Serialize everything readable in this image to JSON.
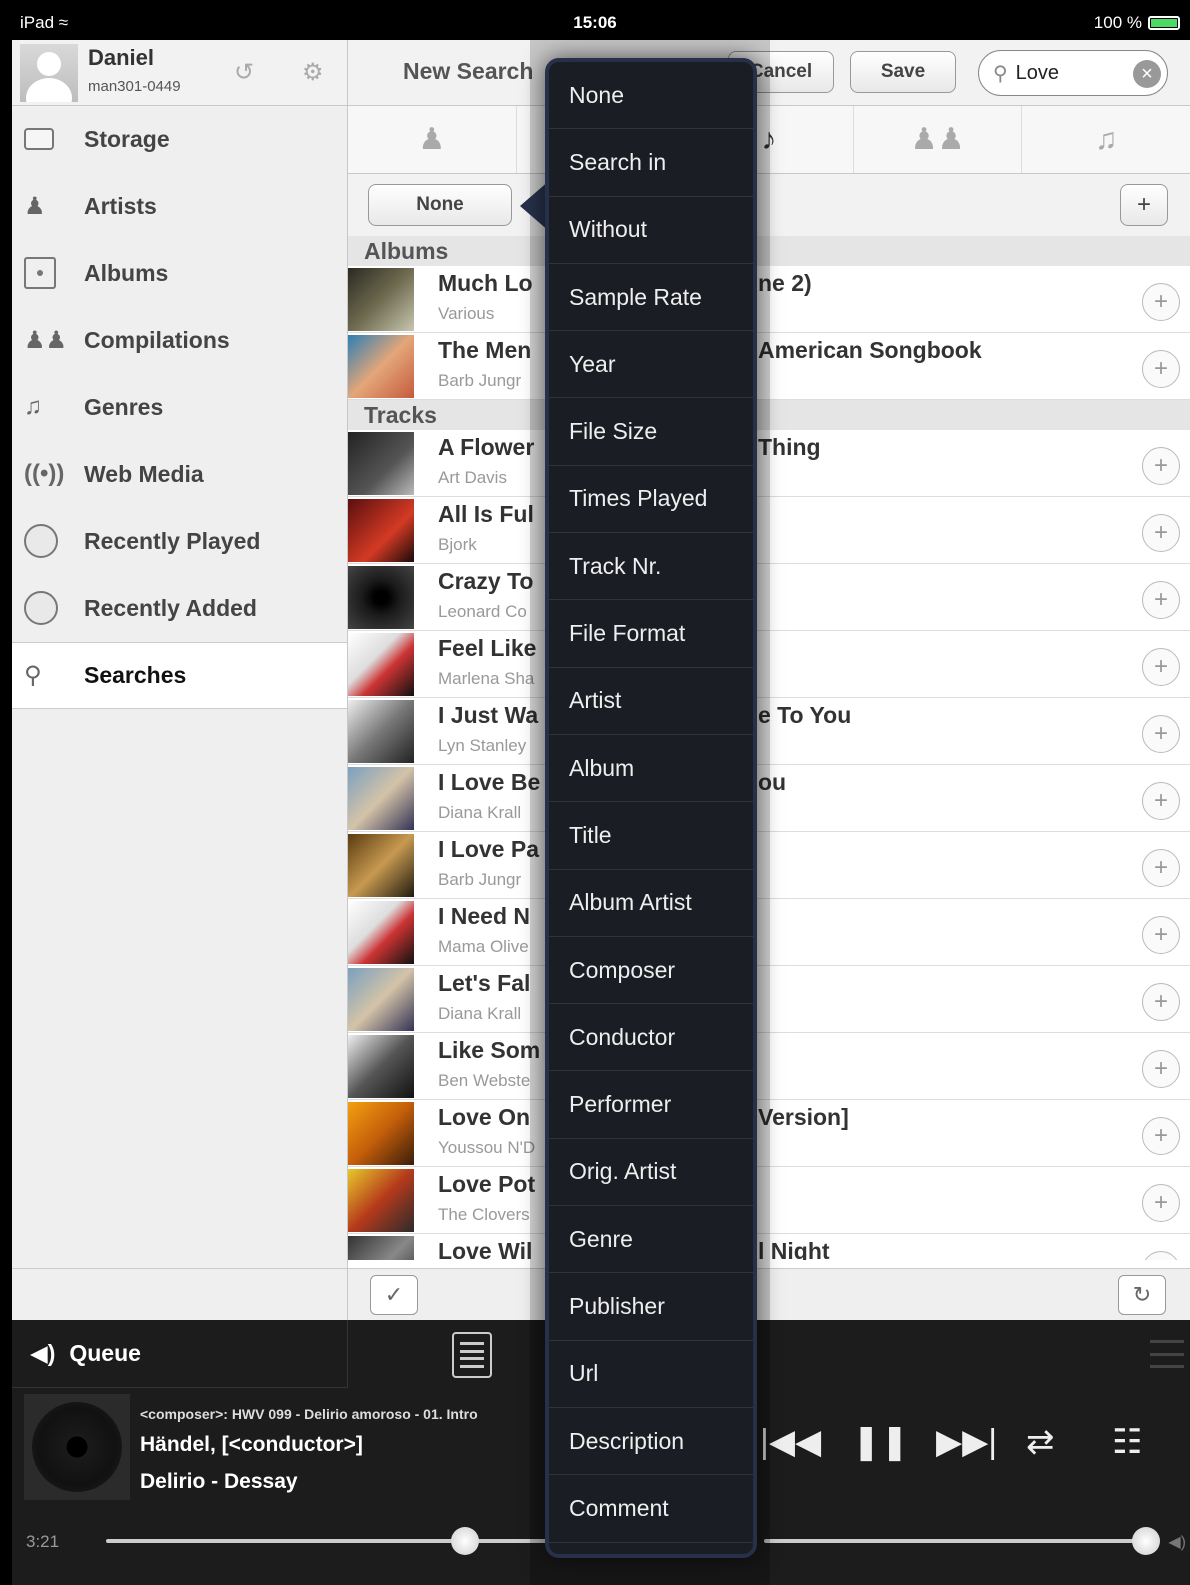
{
  "status": {
    "device": "iPad",
    "time": "15:06",
    "battery": "100 %"
  },
  "profile": {
    "name": "Daniel",
    "account": "man301-0449"
  },
  "sidebar": {
    "items": [
      {
        "label": "Storage",
        "icon": "storage-icon"
      },
      {
        "label": "Artists",
        "icon": "artist-icon"
      },
      {
        "label": "Albums",
        "icon": "album-icon"
      },
      {
        "label": "Compilations",
        "icon": "compilations-icon"
      },
      {
        "label": "Genres",
        "icon": "guitar-icon"
      },
      {
        "label": "Web Media",
        "icon": "broadcast-icon"
      },
      {
        "label": "Recently Played",
        "icon": "clock-icon"
      },
      {
        "label": "Recently Added",
        "icon": "clock-icon"
      },
      {
        "label": "Searches",
        "icon": "search-icon"
      }
    ]
  },
  "toolbar": {
    "title": "New Search",
    "cancel": "Cancel",
    "save": "Save"
  },
  "search": {
    "value": "Love"
  },
  "filter": {
    "none_label": "None",
    "add_label": "+"
  },
  "sections": {
    "albums": "Albums",
    "tracks": "Tracks"
  },
  "albums": [
    {
      "title": "Much Lo",
      "title_right": "ne 2)",
      "artist": "Various"
    },
    {
      "title": "The Men",
      "title_right": "American Songbook",
      "artist": "Barb Jungr"
    }
  ],
  "tracks": [
    {
      "title": "A Flower",
      "title_right": "Thing",
      "artist": "Art Davis"
    },
    {
      "title": "All Is Ful",
      "title_right": "",
      "artist": "Bjork"
    },
    {
      "title": "Crazy To",
      "title_right": "",
      "artist": "Leonard Co"
    },
    {
      "title": "Feel Like",
      "title_right": "",
      "artist": "Marlena Sha"
    },
    {
      "title": "I Just Wa",
      "title_right": "e To You",
      "artist": "Lyn Stanley"
    },
    {
      "title": "I Love Be",
      "title_right": "ou",
      "artist": "Diana Krall"
    },
    {
      "title": "I Love Pa",
      "title_right": "",
      "artist": "Barb Jungr"
    },
    {
      "title": "I Need N",
      "title_right": "",
      "artist": "Mama Olive"
    },
    {
      "title": "Let's Fal",
      "title_right": "",
      "artist": "Diana Krall"
    },
    {
      "title": "Like Som",
      "title_right": "",
      "artist": "Ben Webste"
    },
    {
      "title": "Love On",
      "title_right": "Version]",
      "artist": "Youssou N'D"
    },
    {
      "title": "Love Pot",
      "title_right": "",
      "artist": "The Clovers"
    },
    {
      "title": "Love Wil",
      "title_right": "l Night",
      "artist": ""
    }
  ],
  "menu": {
    "items": [
      "None",
      "Search in",
      "Without",
      "Sample Rate",
      "Year",
      "File Size",
      "Times Played",
      "Track Nr.",
      "File Format",
      "Artist",
      "Album",
      "Title",
      "Album Artist",
      "Composer",
      "Conductor",
      "Performer",
      "Orig. Artist",
      "Genre",
      "Publisher",
      "Url",
      "Description",
      "Comment"
    ]
  },
  "player": {
    "queue_label": "Queue",
    "line1": "<composer>: HWV 099 - Delirio amoroso - 01. Intro",
    "line2": "Händel, [<conductor>]",
    "line3": "Delirio - Dessay",
    "elapsed": "3:21",
    "progress": 0.69,
    "volume": 0.98
  }
}
